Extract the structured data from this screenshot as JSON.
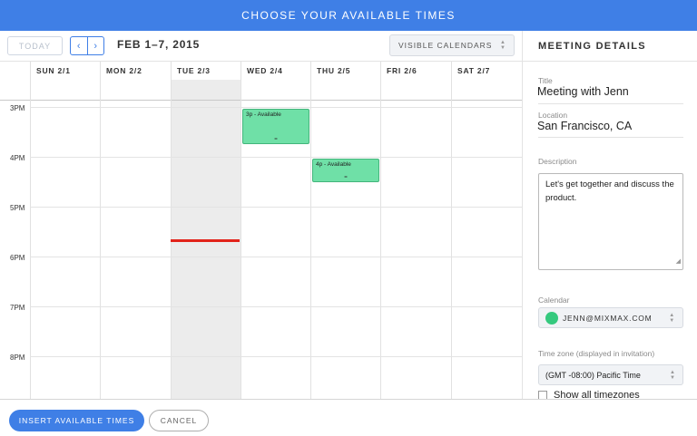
{
  "header": {
    "title": "CHOOSE YOUR AVAILABLE TIMES"
  },
  "toolbar": {
    "today_label": "TODAY",
    "prev_icon": "‹",
    "next_icon": "›",
    "date_range": "FEB 1–7, 2015",
    "visible_calendars_label": "VISIBLE CALENDARS"
  },
  "calendar": {
    "days": [
      "SUN 2/1",
      "MON 2/2",
      "TUE 2/3",
      "WED 2/4",
      "THU 2/5",
      "FRI 2/6",
      "SAT 2/7"
    ],
    "today_index": 2,
    "hours": [
      "3PM",
      "4PM",
      "5PM",
      "6PM",
      "7PM",
      "8PM"
    ],
    "events": [
      {
        "day": "WED 2/4",
        "label": "3p - Available",
        "start": "3:00 PM",
        "end": "3:45 PM",
        "grip": "="
      },
      {
        "day": "THU 2/5",
        "label": "4p - Available",
        "start": "4:00 PM",
        "end": "4:30 PM",
        "grip": "="
      }
    ],
    "current_time": "5:40 PM"
  },
  "panel": {
    "title": "MEETING DETAILS",
    "title_label": "Title",
    "title_value": "Meeting with Jenn",
    "location_label": "Location",
    "location_value": "San Francisco, CA",
    "description_label": "Description",
    "description_value": "Let's get together and discuss the product.",
    "calendar_label": "Calendar",
    "calendar_value": "JENN@MIXMAX.COM",
    "calendar_color": "#35c97e",
    "timezone_label": "Time zone (displayed in invitation)",
    "timezone_value": "(GMT -08:00) Pacific Time",
    "show_all_label": "Show all timezones",
    "show_all_checked": false
  },
  "footer": {
    "insert_label": "INSERT AVAILABLE TIMES",
    "cancel_label": "CANCEL"
  },
  "colors": {
    "accent": "#3f7fe6",
    "event_fill": "#6fe0a7",
    "now_line": "#e2231a"
  }
}
